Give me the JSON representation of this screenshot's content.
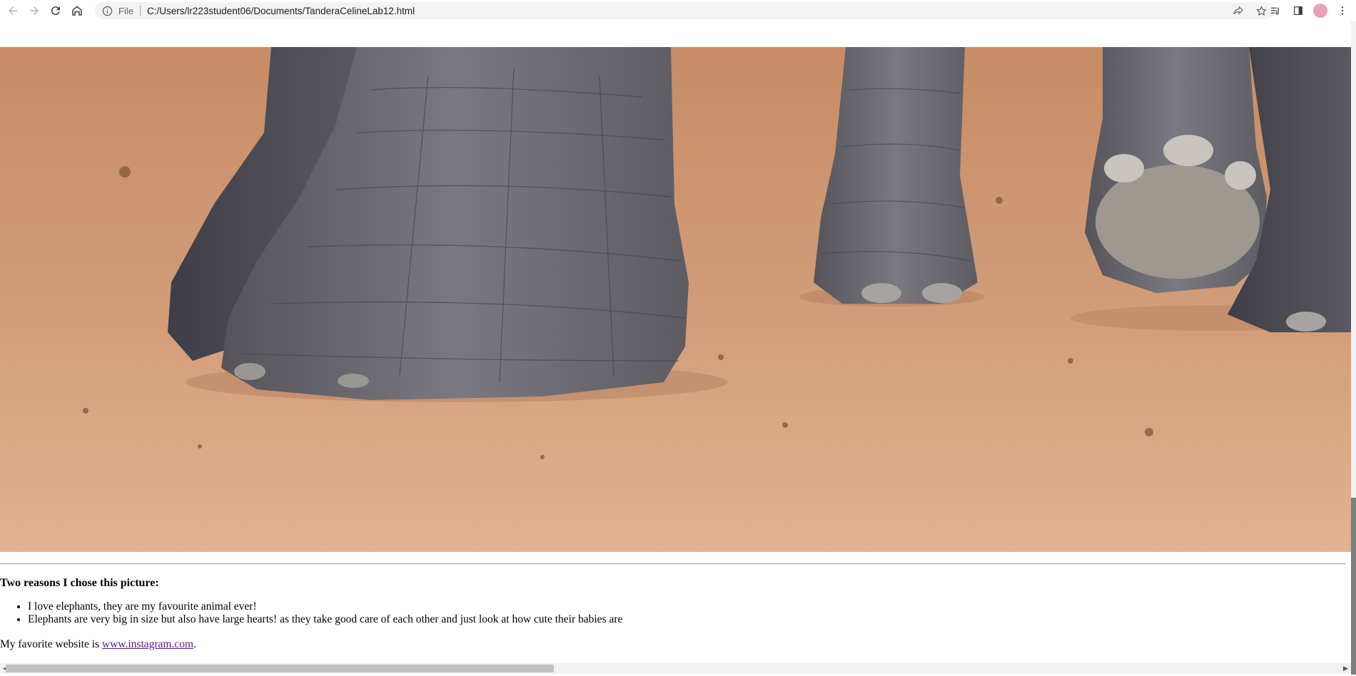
{
  "browser": {
    "scheme": "File",
    "url": "C:/Users/lr223student06/Documents/TanderaCelineLab12.html"
  },
  "page": {
    "image_alt": "Elephant feet on dirt ground",
    "heading": "Two reasons I chose this picture:",
    "reasons": [
      "I love elephants, they are my favourite animal ever!",
      "Elephants are very big in size but also have large hearts! as they take good care of each other and just look at how cute their babies are"
    ],
    "favorite_prefix": "My favorite website is ",
    "favorite_link": "www.instagram.com",
    "favorite_suffix": "."
  },
  "icons": {
    "back": "arrow-left-icon",
    "forward": "arrow-right-icon",
    "reload": "reload-icon",
    "home": "home-icon",
    "info": "info-icon",
    "share": "share-icon",
    "bookmark": "star-icon",
    "reading_list": "reading-list-icon",
    "side_panel": "side-panel-icon",
    "profile": "profile-avatar",
    "menu": "kebab-menu-icon"
  }
}
